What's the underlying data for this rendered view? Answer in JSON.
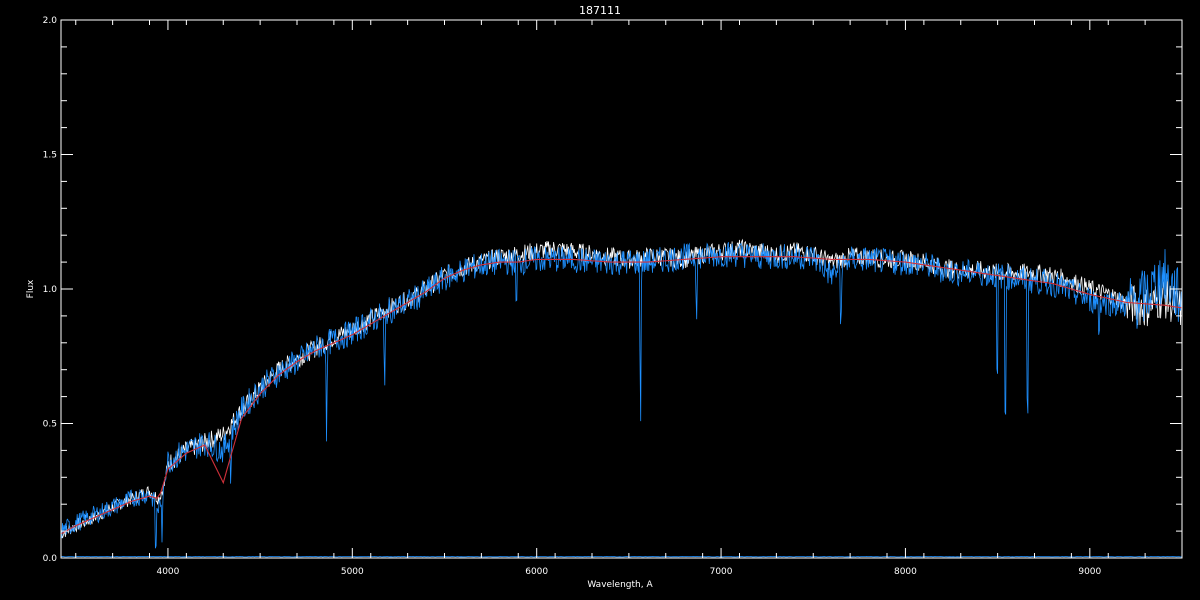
{
  "chart_data": {
    "type": "line",
    "title": "187111",
    "xlabel": "Wavelength, A",
    "ylabel": "Flux",
    "xlim": [
      3420,
      9500
    ],
    "ylim": [
      0.0,
      2.0
    ],
    "xticks": [
      {
        "value": 4000,
        "label": "4000"
      },
      {
        "value": 5000,
        "label": "5000"
      },
      {
        "value": 6000,
        "label": "6000"
      },
      {
        "value": 7000,
        "label": "7000"
      },
      {
        "value": 8000,
        "label": "8000"
      },
      {
        "value": 9000,
        "label": "9000"
      }
    ],
    "yticks": [
      {
        "value": 0.0,
        "label": "0.0"
      },
      {
        "value": 0.5,
        "label": "0.5"
      },
      {
        "value": 1.0,
        "label": "1.0"
      },
      {
        "value": 1.5,
        "label": "1.5"
      },
      {
        "value": 2.0,
        "label": "2.0"
      }
    ],
    "grid": false,
    "colors": {
      "background": "#000000",
      "axes": "#ffffff",
      "observed": "#ffffff",
      "model": "#1e90ff",
      "continuum": "#d0303a"
    },
    "series": [
      {
        "color": "#ffffff",
        "x": [
          3420,
          3500,
          3600,
          3700,
          3800,
          3900,
          3950,
          3980,
          4000,
          4100,
          4200,
          4300,
          4400,
          4500,
          4600,
          4700,
          4800,
          4900,
          5000,
          5100,
          5200,
          5300,
          5400,
          5500,
          5600,
          5700,
          5800,
          5900,
          6000,
          6100,
          6200,
          6300,
          6400,
          6500,
          6600,
          6700,
          6800,
          6900,
          7000,
          7100,
          7200,
          7300,
          7400,
          7500,
          7600,
          7700,
          7800,
          7900,
          8000,
          8100,
          8200,
          8300,
          8400,
          8500,
          8600,
          8700,
          8800,
          8900,
          9000,
          9100,
          9200,
          9300,
          9400,
          9500
        ],
        "y": [
          0.09,
          0.12,
          0.15,
          0.19,
          0.22,
          0.25,
          0.22,
          0.27,
          0.35,
          0.4,
          0.43,
          0.46,
          0.55,
          0.63,
          0.7,
          0.74,
          0.78,
          0.82,
          0.85,
          0.89,
          0.93,
          0.96,
          1.0,
          1.05,
          1.08,
          1.1,
          1.12,
          1.13,
          1.14,
          1.15,
          1.14,
          1.13,
          1.12,
          1.11,
          1.12,
          1.12,
          1.11,
          1.13,
          1.14,
          1.15,
          1.14,
          1.13,
          1.14,
          1.13,
          1.1,
          1.12,
          1.12,
          1.11,
          1.11,
          1.1,
          1.08,
          1.07,
          1.07,
          1.06,
          1.06,
          1.06,
          1.05,
          1.03,
          1.0,
          0.98,
          0.95,
          0.93,
          0.97,
          0.92
        ]
      },
      {
        "color": "#1e90ff",
        "x": [
          3420,
          3500,
          3600,
          3700,
          3800,
          3900,
          3950,
          3980,
          4000,
          4100,
          4200,
          4300,
          4400,
          4500,
          4600,
          4700,
          4800,
          4900,
          5000,
          5100,
          5200,
          5300,
          5400,
          5500,
          5600,
          5700,
          5800,
          5900,
          6000,
          6100,
          6200,
          6300,
          6400,
          6500,
          6600,
          6700,
          6800,
          6900,
          7000,
          7100,
          7200,
          7300,
          7400,
          7500,
          7600,
          7700,
          7800,
          7900,
          8000,
          8100,
          8200,
          8300,
          8400,
          8500,
          8600,
          8700,
          8800,
          8900,
          9000,
          9100,
          9200,
          9300,
          9400,
          9500
        ],
        "y": [
          0.1,
          0.13,
          0.16,
          0.19,
          0.22,
          0.24,
          0.18,
          0.3,
          0.36,
          0.4,
          0.43,
          0.4,
          0.55,
          0.63,
          0.69,
          0.73,
          0.78,
          0.81,
          0.84,
          0.88,
          0.92,
          0.95,
          0.99,
          1.04,
          1.07,
          1.09,
          1.1,
          1.1,
          1.11,
          1.11,
          1.11,
          1.1,
          1.1,
          1.1,
          1.1,
          1.11,
          1.12,
          1.12,
          1.13,
          1.13,
          1.12,
          1.12,
          1.12,
          1.12,
          1.05,
          1.11,
          1.11,
          1.1,
          1.1,
          1.09,
          1.07,
          1.06,
          1.06,
          1.05,
          1.04,
          1.03,
          1.02,
          0.99,
          0.96,
          0.95,
          0.94,
          0.97,
          1.05,
          0.95
        ]
      },
      {
        "color": "#d0303a",
        "x": [
          3420,
          3500,
          3600,
          3700,
          3800,
          3900,
          3950,
          4000,
          4100,
          4200,
          4300,
          4400,
          4500,
          4600,
          4700,
          4800,
          4900,
          5000,
          5100,
          5200,
          5300,
          5400,
          5500,
          5600,
          5700,
          5800,
          5900,
          6000,
          6200,
          6400,
          6600,
          6800,
          7000,
          7200,
          7400,
          7600,
          7800,
          8000,
          8200,
          8400,
          8600,
          8800,
          9000,
          9200,
          9400,
          9500
        ],
        "y": [
          0.09,
          0.12,
          0.15,
          0.18,
          0.21,
          0.23,
          0.22,
          0.33,
          0.39,
          0.42,
          0.28,
          0.52,
          0.61,
          0.68,
          0.73,
          0.77,
          0.8,
          0.83,
          0.87,
          0.91,
          0.95,
          0.99,
          1.04,
          1.07,
          1.09,
          1.1,
          1.1,
          1.11,
          1.11,
          1.1,
          1.1,
          1.11,
          1.12,
          1.12,
          1.12,
          1.11,
          1.11,
          1.1,
          1.08,
          1.06,
          1.04,
          1.02,
          0.98,
          0.95,
          0.94,
          0.93
        ]
      }
    ],
    "absorption_lines": [
      {
        "x": 3934,
        "depth": 0.25
      },
      {
        "x": 3968,
        "depth": 0.22
      },
      {
        "x": 4340,
        "depth": 0.18
      },
      {
        "x": 4861,
        "depth": 0.38
      },
      {
        "x": 5175,
        "depth": 0.35
      },
      {
        "x": 5890,
        "depth": 0.22
      },
      {
        "x": 6563,
        "depth": 0.66
      },
      {
        "x": 6867,
        "depth": 0.22
      },
      {
        "x": 7650,
        "depth": 0.28
      },
      {
        "x": 8498,
        "depth": 0.56
      },
      {
        "x": 8542,
        "depth": 0.74
      },
      {
        "x": 8662,
        "depth": 0.7
      },
      {
        "x": 9050,
        "depth": 0.15
      }
    ]
  }
}
